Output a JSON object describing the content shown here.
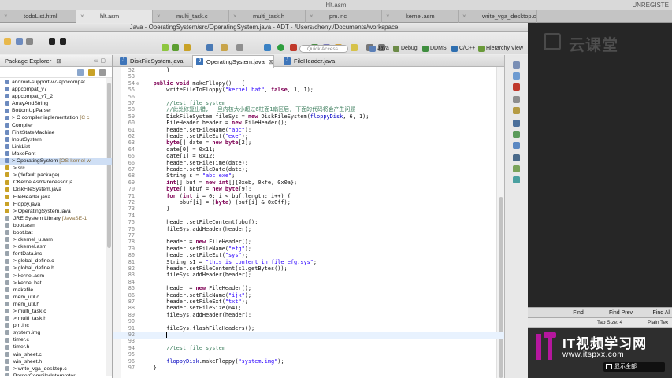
{
  "bg_window": {
    "title": "hlt.asm",
    "right_text": "UNREGISTE",
    "tabs": [
      {
        "label": "todoList.html",
        "active": false
      },
      {
        "label": "hlt.asm",
        "active": true
      },
      {
        "label": "multi_task.c",
        "active": false
      },
      {
        "label": "multi_task.h",
        "active": false
      },
      {
        "label": "pm.inc",
        "active": false
      },
      {
        "label": "kernel.asm",
        "active": false
      },
      {
        "label": "write_vga_desktop.c",
        "active": false
      }
    ]
  },
  "eclipse": {
    "window_title": "Java - OperatingSystem/src/OperatingSystem.java - ADT - /Users/chenyi/Documents/workspace",
    "quick_access_placeholder": "Quick Access",
    "perspectives": [
      "Java",
      "Debug",
      "DDMS",
      "C/C++",
      "Hierarchy View"
    ],
    "package_explorer": {
      "title": "Package Explorer",
      "items": [
        {
          "label": "android-support-v7-appcompat",
          "note": ""
        },
        {
          "label": "appcompat_v7",
          "note": ""
        },
        {
          "label": "appcompat_v7_2",
          "note": ""
        },
        {
          "label": "ArrayAndString",
          "note": ""
        },
        {
          "label": "BottomUpParser",
          "note": ""
        },
        {
          "label": "> C compiler inplementation",
          "note": " [C c"
        },
        {
          "label": "Compiler",
          "note": ""
        },
        {
          "label": "FinitStateMachine",
          "note": ""
        },
        {
          "label": "InputSystem",
          "note": ""
        },
        {
          "label": "LinkList",
          "note": ""
        },
        {
          "label": "MakeFont",
          "note": ""
        },
        {
          "label": "> OperatingSystem",
          "note": " [OS-kernel-w"
        },
        {
          "label": "  > src",
          "note": ""
        },
        {
          "label": "    > (default package)",
          "note": ""
        },
        {
          "label": "      CKernelAsmPrecessor.ja",
          "note": ""
        },
        {
          "label": "      DiskFileSystem.java",
          "note": ""
        },
        {
          "label": "      FileHeader.java",
          "note": ""
        },
        {
          "label": "      Floppy.java",
          "note": ""
        },
        {
          "label": "    > OperatingSystem.java",
          "note": ""
        },
        {
          "label": "  JRE System Library",
          "note": " [JavaSE-1"
        },
        {
          "label": "  boot.asm",
          "note": ""
        },
        {
          "label": "  boot.bat",
          "note": ""
        },
        {
          "label": "  > ckernel_u.asm",
          "note": ""
        },
        {
          "label": "  > ckernel.asm",
          "note": ""
        },
        {
          "label": "  fontData.inc",
          "note": ""
        },
        {
          "label": "  > global_define.c",
          "note": ""
        },
        {
          "label": "  > global_define.h",
          "note": ""
        },
        {
          "label": "  > kernel.asm",
          "note": ""
        },
        {
          "label": "  > kernel.bat",
          "note": ""
        },
        {
          "label": "  makefile",
          "note": ""
        },
        {
          "label": "  mem_util.c",
          "note": ""
        },
        {
          "label": "  mem_util.h",
          "note": ""
        },
        {
          "label": "  > multi_task.c",
          "note": ""
        },
        {
          "label": "  > multi_task.h",
          "note": ""
        },
        {
          "label": "  pm.inc",
          "note": ""
        },
        {
          "label": "  system.img",
          "note": ""
        },
        {
          "label": "  timer.c",
          "note": ""
        },
        {
          "label": "  timer.h",
          "note": ""
        },
        {
          "label": "  win_sheet.c",
          "note": ""
        },
        {
          "label": "  win_sheet.h",
          "note": ""
        },
        {
          "label": "  > write_vga_desktop.c",
          "note": ""
        },
        {
          "label": "  ParserCompilerInterpreter",
          "note": ""
        }
      ]
    },
    "editor_tabs": [
      {
        "label": "DiskFileSystem.java",
        "active": false
      },
      {
        "label": "OperatingSystem.java",
        "active": true
      },
      {
        "label": "FileHeader.java",
        "active": false
      }
    ],
    "code_lines": [
      {
        "n": "52",
        "t": "        }"
      },
      {
        "n": "53",
        "t": ""
      },
      {
        "n": "54",
        "t": "    public void makeFllopy()   {"
      },
      {
        "n": "55",
        "t": "        writeFileToFloppy(\"kernel.bat\", false, 1, 1);"
      },
      {
        "n": "56",
        "t": ""
      },
      {
        "n": "57",
        "t": "        //test file system"
      },
      {
        "n": "58",
        "t": "        //此处修复出错, 一旦内核大小超过6柱面1扇区后, 下面的代码将会产生问题"
      },
      {
        "n": "59",
        "t": "        DiskFileSystem fileSys = new DiskFileSystem(floppyDisk, 6, 1);"
      },
      {
        "n": "60",
        "t": "        FileHeader header = new FileHeader();"
      },
      {
        "n": "61",
        "t": "        header.setFileName(\"abc\");"
      },
      {
        "n": "62",
        "t": "        header.setFileExt(\"exe\");"
      },
      {
        "n": "63",
        "t": "        byte[] date = new byte[2];"
      },
      {
        "n": "64",
        "t": "        date[0] = 0x11;"
      },
      {
        "n": "65",
        "t": "        date[1] = 0x12;"
      },
      {
        "n": "66",
        "t": "        header.setFileTime(date);"
      },
      {
        "n": "67",
        "t": "        header.setFileDate(date);"
      },
      {
        "n": "68",
        "t": "        String s = \"abc.exe\";"
      },
      {
        "n": "69",
        "t": "        int[] buf = new int[]{0xeb, 0xfe, 0x0a};"
      },
      {
        "n": "70",
        "t": "        byte[] bbuf = new byte[9];"
      },
      {
        "n": "71",
        "t": "        for (int i = 0; i < buf.length; i++) {"
      },
      {
        "n": "72",
        "t": "            bbuf[i] = (byte) (buf[i] & 0x0ff);"
      },
      {
        "n": "73",
        "t": "        }"
      },
      {
        "n": "74",
        "t": ""
      },
      {
        "n": "75",
        "t": "        header.setFileContent(bbuf);"
      },
      {
        "n": "76",
        "t": "        fileSys.addHeader(header);"
      },
      {
        "n": "77",
        "t": ""
      },
      {
        "n": "78",
        "t": "        header = new FileHeader();"
      },
      {
        "n": "79",
        "t": "        header.setFileName(\"efg\");"
      },
      {
        "n": "80",
        "t": "        header.setFileExt(\"sys\");"
      },
      {
        "n": "81",
        "t": "        String s1 = \"this is content in file efg.sys\";"
      },
      {
        "n": "82",
        "t": "        header.setFileContent(s1.getBytes());"
      },
      {
        "n": "83",
        "t": "        fileSys.addHeader(header);"
      },
      {
        "n": "84",
        "t": ""
      },
      {
        "n": "85",
        "t": "        header = new FileHeader();"
      },
      {
        "n": "86",
        "t": "        header.setFileName(\"ijk\");"
      },
      {
        "n": "87",
        "t": "        header.setFileExt(\"txt\");"
      },
      {
        "n": "88",
        "t": "        header.setFileSize(64);"
      },
      {
        "n": "89",
        "t": "        fileSys.addHeader(header);"
      },
      {
        "n": "90",
        "t": ""
      },
      {
        "n": "91",
        "t": "        fileSys.flashFileHeaders();"
      },
      {
        "n": "92",
        "t": "        "
      },
      {
        "n": "93",
        "t": ""
      },
      {
        "n": "94",
        "t": "        //test file system"
      },
      {
        "n": "95",
        "t": ""
      },
      {
        "n": "96",
        "t": "        floppyDisk.makeFloppy(\"system.img\");"
      },
      {
        "n": "97",
        "t": "    }"
      }
    ],
    "current_line": "92"
  },
  "right_panel": {
    "logo_text": "云课堂",
    "find_buttons": [
      "Find",
      "Find Prev",
      "Find All"
    ],
    "tab_size": "Tab Size: 4",
    "syntax": "Plain Tex"
  },
  "watermark": {
    "line1": "IT视频学习网",
    "line2": "www.itspxx.com",
    "fullscreen_label": "显示全部"
  }
}
